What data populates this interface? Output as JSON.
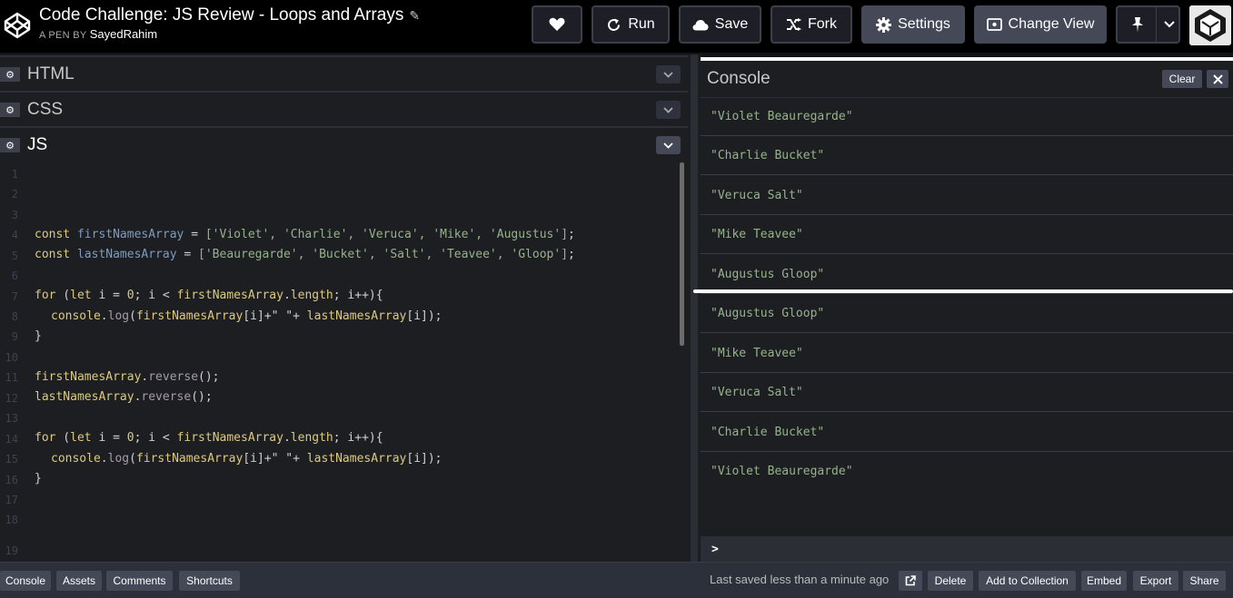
{
  "header": {
    "title": "Code Challenge: JS Review - Loops and Arrays",
    "byline_prefix": "A PEN BY",
    "author": "SayedRahim",
    "buttons": {
      "run": "Run",
      "save": "Save",
      "fork": "Fork",
      "settings": "Settings",
      "change_view": "Change View"
    }
  },
  "editors": {
    "html_label": "HTML",
    "css_label": "CSS",
    "js_label": "JS"
  },
  "code": {
    "lines": [
      {
        "n": "1"
      },
      {
        "n": "2"
      },
      {
        "n": "3"
      },
      {
        "n": "4"
      },
      {
        "n": "5"
      },
      {
        "n": "6"
      },
      {
        "n": "7"
      },
      {
        "n": "8"
      },
      {
        "n": "9"
      },
      {
        "n": "10"
      },
      {
        "n": "11"
      },
      {
        "n": "12"
      },
      {
        "n": "13"
      },
      {
        "n": "14"
      },
      {
        "n": "15"
      },
      {
        "n": "16"
      },
      {
        "n": "17"
      },
      {
        "n": "18"
      },
      {
        "n": "19"
      }
    ],
    "tokens": {
      "const": "const",
      "for": "for",
      "let": "let",
      "first_arr": "firstNamesArray",
      "last_arr": "lastNamesArray",
      "length": "length",
      "console": "console",
      "log": "log",
      "reverse": "reverse",
      "first_values": "['Violet', 'Charlie', 'Veruca', 'Mike', 'Augustus']",
      "last_values": "['Beauregarde', 'Bucket', 'Salt', 'Teavee', 'Gloop']",
      "space_str": "\" \"",
      "zero": "0"
    }
  },
  "console": {
    "title": "Console",
    "clear_label": "Clear",
    "entries": [
      "\"Violet Beauregarde\"",
      "\"Charlie Bucket\"",
      "\"Veruca Salt\"",
      "\"Mike Teavee\"",
      "\"Augustus Gloop\"",
      "\"Augustus Gloop\"",
      "\"Mike Teavee\"",
      "\"Veruca Salt\"",
      "\"Charlie Bucket\"",
      "\"Violet Beauregarde\""
    ],
    "prompt": ">"
  },
  "footer": {
    "console": "Console",
    "assets": "Assets",
    "comments": "Comments",
    "shortcuts": "Shortcuts",
    "saved_status": "Last saved less than a minute ago",
    "delete": "Delete",
    "add_to_collection": "Add to Collection",
    "embed": "Embed",
    "export": "Export",
    "share": "Share"
  },
  "colors": {
    "keyword": "#ddca7e",
    "variable": "#809bbd",
    "string": "#96b38a",
    "property": "#a59ba8",
    "button_gray": "#444857"
  }
}
